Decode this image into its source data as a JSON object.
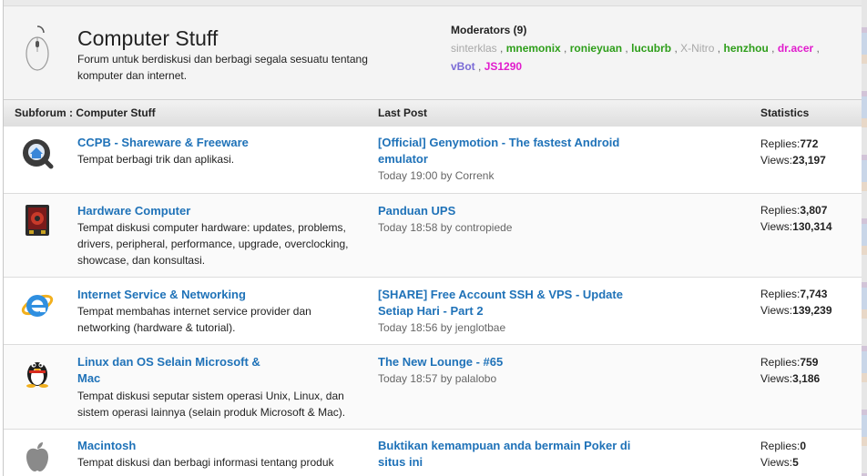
{
  "forum": {
    "title": "Computer Stuff",
    "description": "Forum untuk berdiskusi dan berbagi segala sesuatu tentang komputer dan internet."
  },
  "moderators": {
    "heading": "Moderators (9)",
    "list": [
      {
        "name": "sinterklas",
        "color": "#a8a8a8"
      },
      {
        "name": "mnemonix",
        "color": "#2e9e1a"
      },
      {
        "name": "ronieyuan",
        "color": "#2e9e1a"
      },
      {
        "name": "lucubrb",
        "color": "#2e9e1a"
      },
      {
        "name": "X-Nitro",
        "color": "#a8a8a8"
      },
      {
        "name": "henzhou",
        "color": "#2e9e1a"
      },
      {
        "name": "dr.acer",
        "color": "#e11ccd"
      },
      {
        "name": "vBot",
        "color": "#7a6bd6"
      },
      {
        "name": "JS1290",
        "color": "#e11ccd"
      }
    ]
  },
  "table": {
    "col_subforum": "Subforum : Computer Stuff",
    "col_lastpost": "Last Post",
    "col_stats": "Statistics",
    "replies_label": "Replies:",
    "views_label": "Views:",
    "by_label": "by"
  },
  "rows": [
    {
      "icon": "ccpb-icon",
      "title": "CCPB - Shareware & Freeware",
      "desc": "Tempat berbagi trik dan aplikasi.",
      "lp_title": "[Official] Genymotion - The fastest Android emulator",
      "lp_time": "Today 19:00",
      "lp_user": "Correnk",
      "replies": "772",
      "views": "23,197"
    },
    {
      "icon": "hardware-icon",
      "title": "Hardware Computer",
      "desc": "Tempat diskusi computer hardware: updates, problems, drivers, peripheral, performance, upgrade, overclocking, showcase, dan konsultasi.",
      "lp_title": "Panduan UPS",
      "lp_time": "Today 18:58",
      "lp_user": "contropiede",
      "replies": "3,807",
      "views": "130,314"
    },
    {
      "icon": "internet-explorer-icon",
      "title": "Internet Service & Networking",
      "desc": "Tempat membahas internet service provider dan networking (hardware & tutorial).",
      "lp_title": "[SHARE] Free Account SSH & VPS - Update Setiap Hari - Part 2",
      "lp_time": "Today 18:56",
      "lp_user": "jenglotbae",
      "replies": "7,743",
      "views": "139,239"
    },
    {
      "icon": "linux-penguin-icon",
      "title": "Linux dan OS Selain Microsoft & Mac",
      "desc": "Tempat diskusi seputar sistem operasi Unix, Linux, dan sistem operasi lainnya (selain produk Microsoft & Mac).",
      "lp_title": "The New Lounge - #65",
      "lp_time": "Today 18:57",
      "lp_user": "palalobo",
      "replies": "759",
      "views": "3,186"
    },
    {
      "icon": "apple-icon",
      "title": "Macintosh",
      "desc": "Tempat diskusi dan berbagi informasi tentang produk",
      "lp_title": "Buktikan kemampuan anda bermain Poker di situs ini",
      "lp_time": "",
      "lp_user": "",
      "replies": "0",
      "views": "5"
    }
  ]
}
